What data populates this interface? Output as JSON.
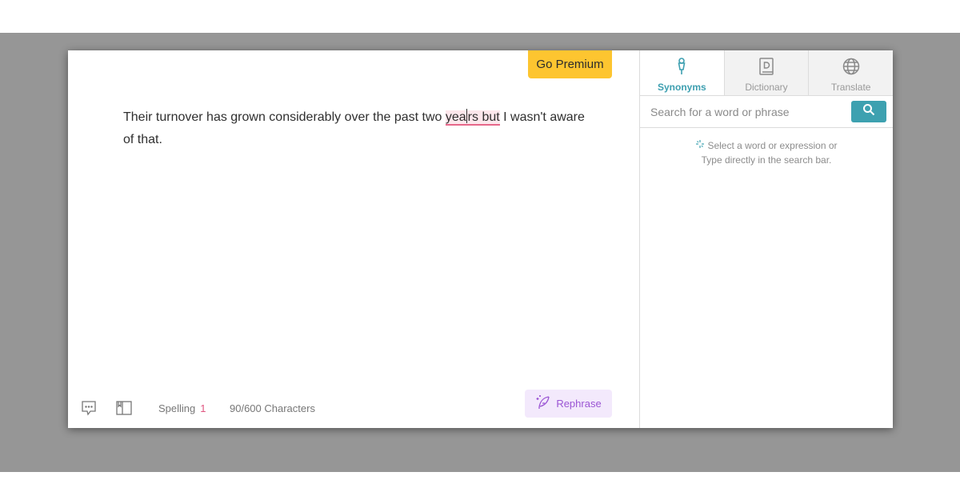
{
  "editor": {
    "premium_label": "Go Premium",
    "text_before": "Their turnover has grown considerably over the past two ",
    "error_part1": "yea",
    "error_part2": "rs but",
    "text_after": " I wasn't aware of that."
  },
  "bottom_bar": {
    "spelling_label": "Spelling",
    "spelling_count": "1",
    "characters": "90/600 Characters",
    "rephrase_label": "Rephrase",
    "icons": [
      "comment-icon",
      "book-panel-icon",
      "feather-sparkle-icon"
    ]
  },
  "sidebar": {
    "tabs": [
      {
        "label": "Synonyms",
        "icon": "pen-icon",
        "active": true
      },
      {
        "label": "Dictionary",
        "icon": "dictionary-icon",
        "active": false
      },
      {
        "label": "Translate",
        "icon": "globe-icon",
        "active": false
      }
    ],
    "search": {
      "placeholder": "Search for a word or phrase",
      "value": ""
    },
    "hint_line1": "Select a word or expression or",
    "hint_line2": "Type directly in the search bar."
  },
  "colors": {
    "accent": "#3da1b0",
    "premium": "#fdc530",
    "error": "#e6678a",
    "rephrase": "#9b55d4"
  }
}
